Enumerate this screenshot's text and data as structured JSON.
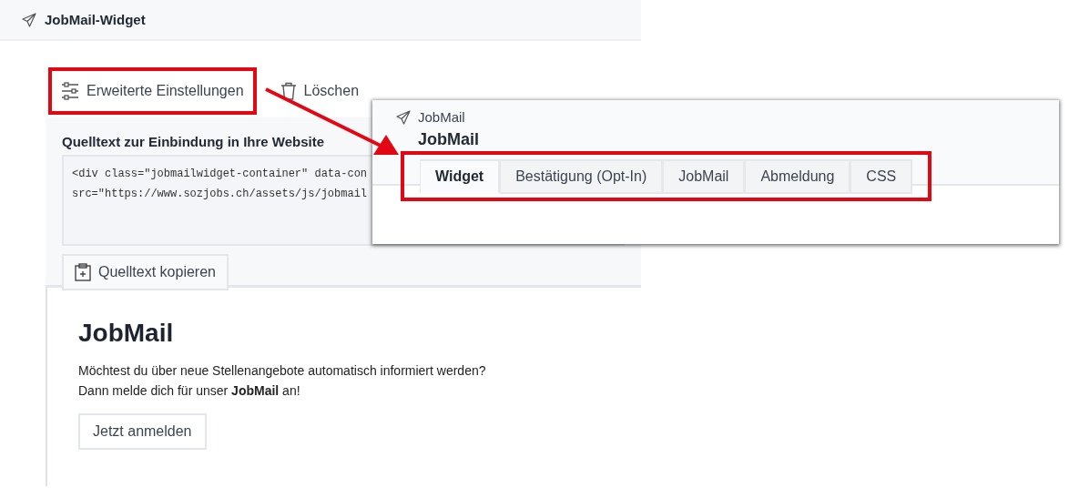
{
  "header": {
    "title": "JobMail-Widget"
  },
  "actions": [
    {
      "label": "Erweiterte Einstellungen",
      "kind": "settings",
      "highlighted": true
    },
    {
      "label": "Löschen",
      "kind": "delete",
      "highlighted": false
    }
  ],
  "embed": {
    "heading": "Quelltext zur Einbindung in Ihre Website",
    "code_lines": [
      "<div class=\"jobmailwidget-container\" data-con",
      "src=\"https://www.sozjobs.ch/assets/js/jobmail"
    ],
    "copy_button": "Quelltext kopieren"
  },
  "preview": {
    "title": "JobMail",
    "lines": [
      "Möchtest du über neue Stellenangebote automatisch informiert werden?",
      "Dann melde dich für unser **JobMail** an!"
    ],
    "button": "Jetzt anmelden"
  },
  "popup": {
    "breadcrumb": "JobMail",
    "title": "JobMail",
    "tabs_highlighted": true,
    "tabs": [
      {
        "label": "Widget",
        "selected": true
      },
      {
        "label": "Bestätigung (Opt-In)",
        "selected": false
      },
      {
        "label": "JobMail",
        "selected": false
      },
      {
        "label": "Abmeldung",
        "selected": false
      },
      {
        "label": "CSS",
        "selected": false
      }
    ]
  }
}
